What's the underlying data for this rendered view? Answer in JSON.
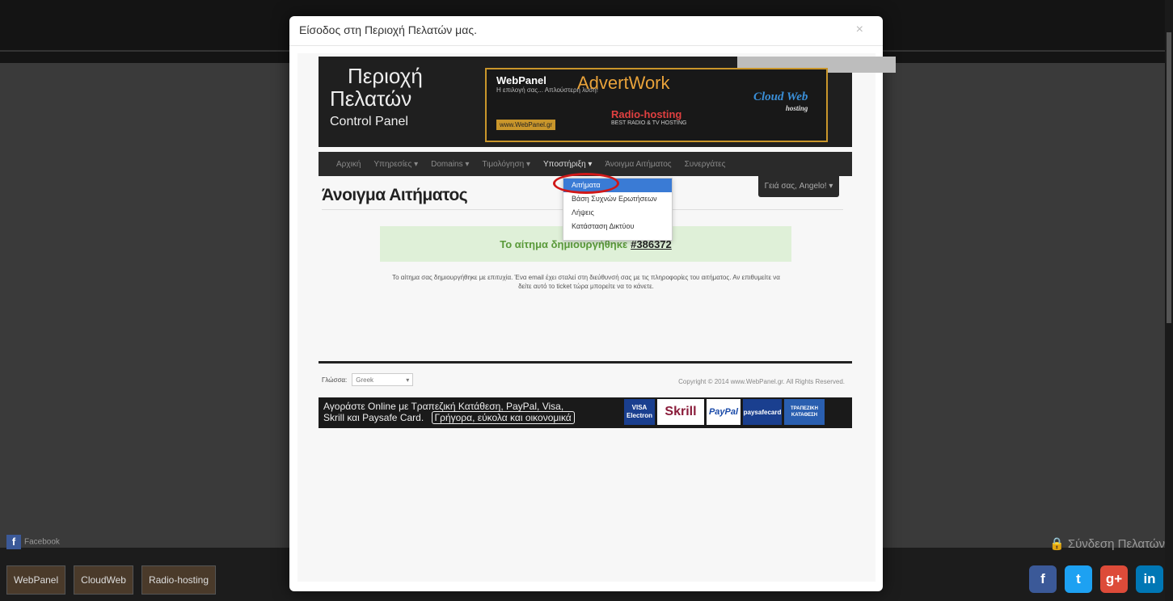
{
  "background": {
    "fb_like": "Facebook",
    "client_login": "Σύνδεση Πελατών",
    "bottom_logos": [
      "WebPanel",
      "CloudWeb",
      "Radio-hosting"
    ],
    "socials": [
      "f",
      "t",
      "g+",
      "in"
    ]
  },
  "modal": {
    "title": "Είσοδος στη Περιοχή Πελατών μας.",
    "close": "×"
  },
  "banner": {
    "line1": "Περιοχή",
    "line2": "Πελατών",
    "line3": "Control Panel",
    "ads": {
      "webpanel": "WebPanel",
      "webpanel_sub": "Η επιλογή σας... Απλούστερη λύση!",
      "webpanel_site": "www.WebPanel.gr",
      "advertwork": "AdvertWork",
      "radio": "Radio-hosting",
      "radio_sub": "BEST RADIO & TV HOSTING",
      "cloud": "Cloud Web",
      "cloud_sub": "hosting"
    }
  },
  "nav": {
    "items": [
      "Αρχική",
      "Υπηρεσίες ▾",
      "Domains ▾",
      "Τιμολόγηση ▾",
      "Υποστήριξη ▾",
      "Άνοιγμα Αιτήματος",
      "Συνεργάτες"
    ],
    "greeting": "Γειά σας, Angelo! ▾"
  },
  "dropdown": {
    "items": [
      "Αιτήματα",
      "Βάση Συχνών Ερωτήσεων",
      "Λήψεις",
      "Κατάσταση Δικτύου"
    ]
  },
  "page": {
    "title": "Άνοιγμα Αιτήματος",
    "success_text": "Το αίτημα δημιουργήθηκε",
    "ticket_number": "#386372",
    "message": "Το αίτημα σας δημιουργήθηκε με επιτυχία. Ένα email έχει σταλεί στη διεύθυνσή σας με τις πληροφορίες του αιτήματος. Αν επιθυμείτε να δείτε αυτό το ticket τώρα μπορείτε να το κάνετε."
  },
  "footer": {
    "language_label": "Γλώσσα:",
    "language_value": "Greek",
    "copyright": "Copyright © 2014 www.WebPanel.gr. All Rights Reserved."
  },
  "payment": {
    "line1": "Αγοράστε Online με Τραπεζική Κατάθεση, PayPal, Visa,",
    "line2": "Skrill και Paysafe Card.",
    "tagline": "Γρήγορα, εύκολα και οικονομικά",
    "logos": [
      "VISA Electron",
      "Skrill",
      "PayPal",
      "paysafecard",
      "ΤΡΑΠΕΖΙΚΗ ΚΑΤΑΘΕΣΗ"
    ]
  },
  "colors": {
    "accent": "#3a7bd5",
    "success_bg": "#dff0d8",
    "success_text": "#5a9a3a",
    "highlight": "#d01818",
    "banner_gold": "#c9962b"
  }
}
